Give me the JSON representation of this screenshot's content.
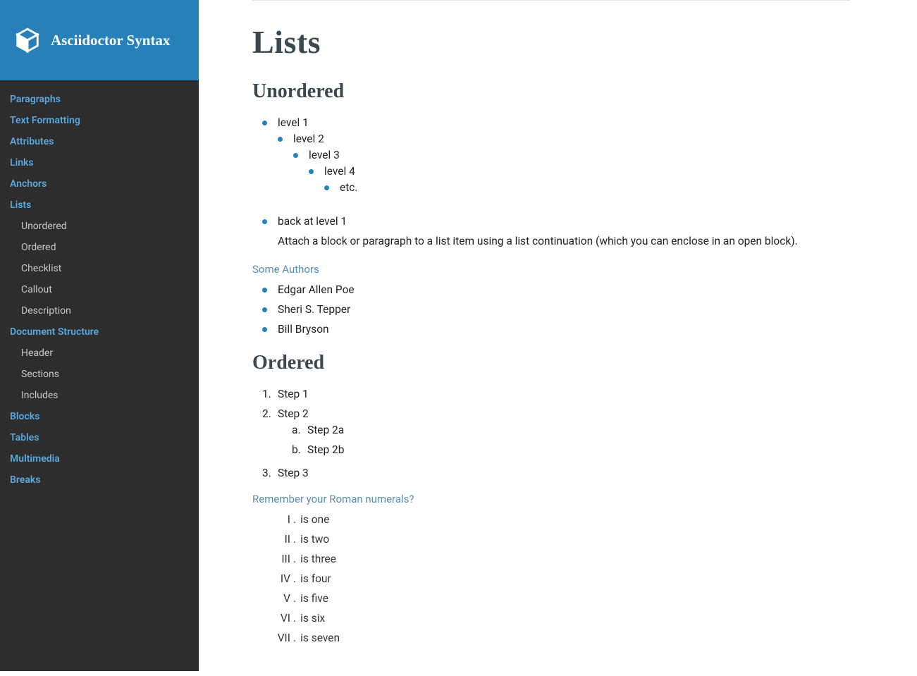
{
  "header": {
    "title": "Asciidoctor Syntax"
  },
  "nav": {
    "paragraphs": "Paragraphs",
    "text_formatting": "Text Formatting",
    "attributes": "Attributes",
    "links": "Links",
    "anchors": "Anchors",
    "lists": "Lists",
    "lists_unordered": "Unordered",
    "lists_ordered": "Ordered",
    "lists_checklist": "Checklist",
    "lists_callout": "Callout",
    "lists_description": "Description",
    "doc_structure": "Document Structure",
    "doc_header": "Header",
    "doc_sections": "Sections",
    "doc_includes": "Includes",
    "blocks": "Blocks",
    "tables": "Tables",
    "multimedia": "Multimedia",
    "breaks": "Breaks"
  },
  "main": {
    "h1": "Lists",
    "unordered": {
      "heading": "Unordered",
      "l1": "level 1",
      "l2": "level 2",
      "l3": "level 3",
      "l4": "level 4",
      "l5": "etc.",
      "back": "back at level 1",
      "para": "Attach a block or paragraph to a list item using a list continuation (which you can enclose in an open block).",
      "authors_title": "Some Authors",
      "a1": "Edgar Allen Poe",
      "a2": "Sheri S. Tepper",
      "a3": "Bill Bryson"
    },
    "ordered": {
      "heading": "Ordered",
      "s1": "Step 1",
      "s2": "Step 2",
      "s2a": "Step 2a",
      "s2b": "Step 2b",
      "s3": "Step 3",
      "roman_title": "Remember your Roman numerals?",
      "r1n": "I",
      "r1": "is one",
      "r2n": "II",
      "r2": "is two",
      "r3n": "III",
      "r3": "is three",
      "r4n": "IV",
      "r4": "is four",
      "r5n": "V",
      "r5": "is five",
      "r6n": "VI",
      "r6": "is six",
      "r7n": "VII",
      "r7": "is seven"
    }
  }
}
